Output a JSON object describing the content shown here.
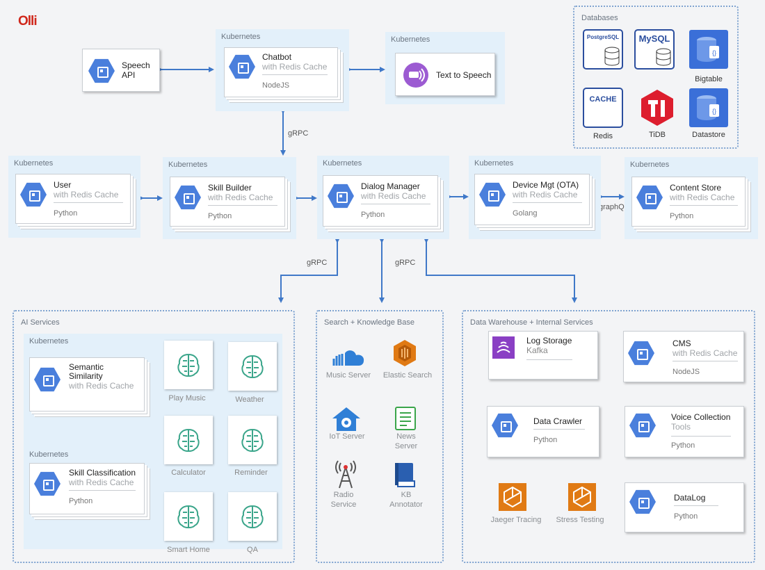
{
  "brand": "Olli",
  "k8s_label": "Kubernetes",
  "speech": {
    "line1": "Speech",
    "line2": "API"
  },
  "chatbot": {
    "title": "Chatbot",
    "sub": "with Redis Cache",
    "lang": "NodeJS"
  },
  "tts": {
    "title": "Text to Speech"
  },
  "databases": {
    "title": "Databases",
    "items": [
      "PostgreSQL",
      "MySQL",
      "Bigtable",
      "Redis",
      "TiDB",
      "Datastore"
    ],
    "cache_text": "CACHE"
  },
  "links": {
    "grpc": "gRPC",
    "graphql": "graphQL"
  },
  "row": [
    {
      "title": "User",
      "sub": "with Redis Cache",
      "lang": "Python"
    },
    {
      "title": "Skill Builder",
      "sub": "with Redis Cache",
      "lang": "Python"
    },
    {
      "title": "Dialog Manager",
      "sub": "with Redis Cache",
      "lang": "Python"
    },
    {
      "title": "Device Mgt (OTA)",
      "sub": "with Redis Cache",
      "lang": "Golang"
    },
    {
      "title": "Content Store",
      "sub": "with Redis Cache",
      "lang": "Python"
    }
  ],
  "ai": {
    "title": "AI Services",
    "semantic": {
      "line1": "Semantic",
      "line2": "Similarity",
      "sub": "with Redis Cache"
    },
    "skillclass": {
      "title": "Skill Classification",
      "sub": "with Redis Cache",
      "lang": "Python"
    },
    "services": [
      "Play Music",
      "Weather",
      "Calculator",
      "Reminder",
      "Smart Home",
      "QA"
    ]
  },
  "search": {
    "title": "Search + Knowledge Base",
    "items": [
      {
        "l1": "Music Server",
        "l2": ""
      },
      {
        "l1": "Elastic Search",
        "l2": ""
      },
      {
        "l1": "IoT Server",
        "l2": ""
      },
      {
        "l1": "News",
        "l2": "Server"
      },
      {
        "l1": "Radio",
        "l2": "Service"
      },
      {
        "l1": "KB",
        "l2": "Annotator"
      }
    ]
  },
  "dw": {
    "title": "Data Warehouse + Internal Services",
    "log": {
      "title": "Log Storage",
      "sub": "Kafka"
    },
    "cms": {
      "title": "CMS",
      "sub": "with Redis Cache",
      "lang": "NodeJS"
    },
    "crawler": {
      "title": "Data Crawler",
      "lang": "Python"
    },
    "voice": {
      "title": "Voice Collection",
      "sub": "Tools",
      "lang": "Python"
    },
    "jaeger": "Jaeger Tracing",
    "stress": "Stress Testing",
    "datalog": {
      "title": "DataLog",
      "lang": "Python"
    }
  },
  "colors": {
    "accent": "#4a7fdc",
    "arrow": "#3f78c8",
    "kube": "#e3f0fa",
    "brand": "#d0281c",
    "aws": "#e07a14"
  }
}
